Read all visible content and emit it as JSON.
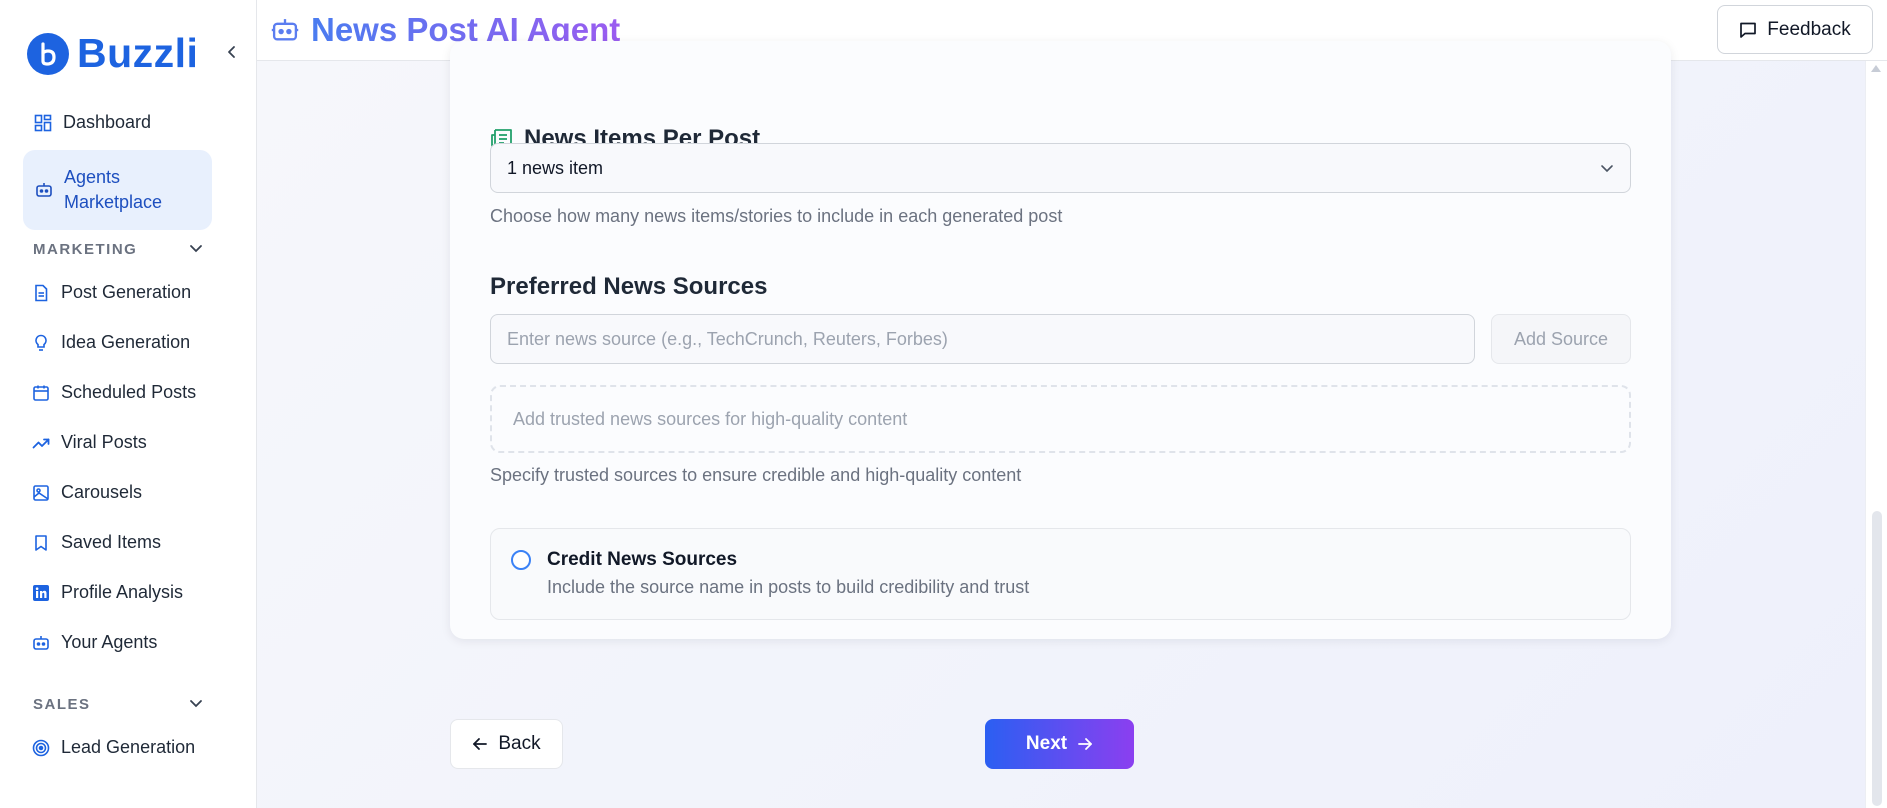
{
  "brand": {
    "name": "Buzzli"
  },
  "sidebar": {
    "items": [
      {
        "label": "Dashboard",
        "icon": "dashboard-icon"
      },
      {
        "label": "Agents Marketplace",
        "icon": "bot-icon",
        "active": true
      }
    ],
    "sections": [
      {
        "title": "MARKETING",
        "items": [
          {
            "label": "Post Generation",
            "icon": "document-icon"
          },
          {
            "label": "Idea Generation",
            "icon": "lightbulb-icon"
          },
          {
            "label": "Scheduled Posts",
            "icon": "calendar-icon"
          },
          {
            "label": "Viral Posts",
            "icon": "trending-up-icon"
          },
          {
            "label": "Carousels",
            "icon": "image-icon"
          },
          {
            "label": "Saved Items",
            "icon": "bookmark-icon"
          },
          {
            "label": "Profile Analysis",
            "icon": "linkedin-icon"
          },
          {
            "label": "Your Agents",
            "icon": "bot-icon"
          }
        ]
      },
      {
        "title": "SALES",
        "items": [
          {
            "label": "Lead Generation",
            "icon": "target-icon"
          }
        ]
      }
    ]
  },
  "header": {
    "title": "News Post AI Agent",
    "feedback_label": "Feedback"
  },
  "form": {
    "news_items": {
      "title": "News Items Per Post",
      "selected": "1 news item",
      "help": "Choose how many news items/stories to include in each generated post"
    },
    "sources": {
      "title": "Preferred News Sources",
      "placeholder": "Enter news source (e.g., TechCrunch, Reuters, Forbes)",
      "add_label": "Add Source",
      "empty_text": "Add trusted news sources for high-quality content",
      "help": "Specify trusted sources to ensure credible and high-quality content"
    },
    "credit": {
      "title": "Credit News Sources",
      "description": "Include the source name in posts to build credibility and trust"
    }
  },
  "nav": {
    "back_label": "Back",
    "next_label": "Next"
  },
  "colors": {
    "brand": "#1d63e0",
    "accent_start": "#2b5ff2",
    "accent_end": "#8b3ff0",
    "news_icon": "#22a06b"
  }
}
